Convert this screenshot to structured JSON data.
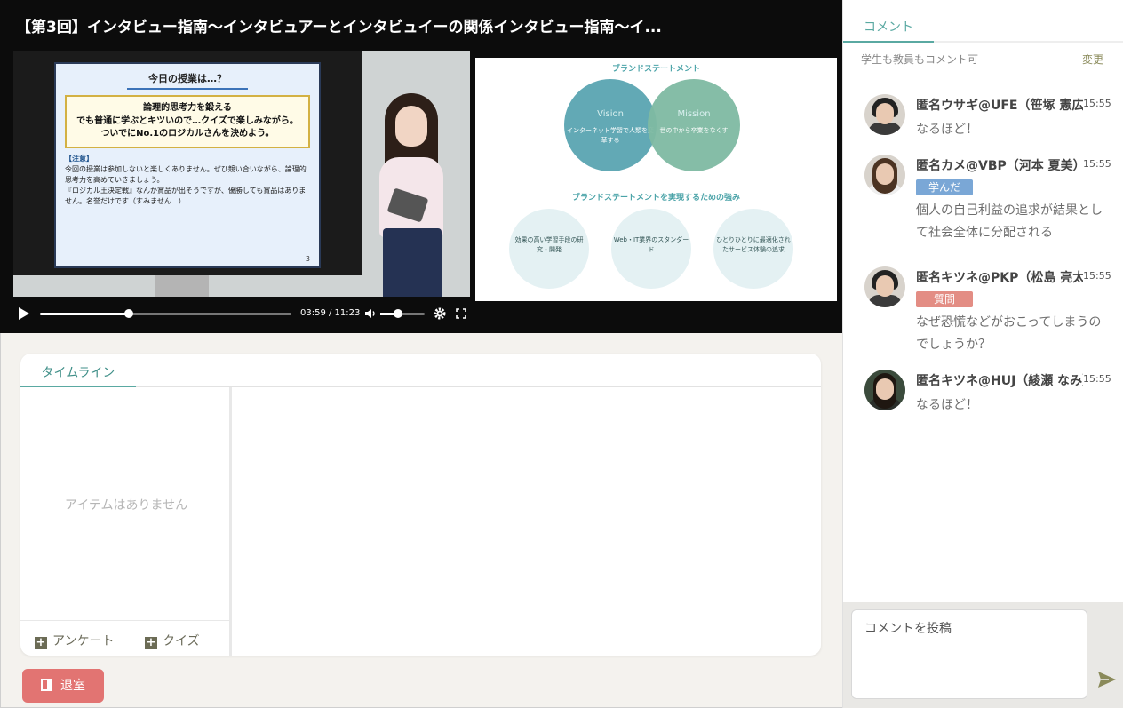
{
  "video": {
    "title": "【第3回】インタビュー指南〜インタビュアーとインタビュイーの関係インタビュー指南〜イ...",
    "time_display": "03:59 / 11:23",
    "progress_fraction": 0.353,
    "volume_fraction": 0.4,
    "camera_slide": {
      "heading": "今日の授業は…？",
      "box_lines": [
        "論理的思考力を鍛える",
        "でも普通に学ぶとキツいので…クイズで楽しみながら。",
        "ついでにNo.1のロジカルさんを決めよう。"
      ],
      "note_title": "【注意】",
      "notes": [
        "今回の授業は参加しないと楽しくありません。ぜひ競い合いながら、論理的思考力を高めていきましょう。",
        "『ロジカル王決定戦』なんか賞品が出そうですが、優勝しても賞品はありません。名誉だけです（すみません…）"
      ],
      "page": "3"
    },
    "doc_slide": {
      "title1": "ブランドステートメント",
      "vision_word": "Vision",
      "vision_text": "インターネット学習で人類を変革する",
      "mission_word": "Mission",
      "mission_text": "世の中から卒業をなくす",
      "title2": "ブランドステートメントを実現するための強み",
      "strengths": [
        "効果の高い学習手段の研究・開発",
        "Web・IT業界のスタンダード",
        "ひとりひとりに最適化されたサービス体験の追求"
      ]
    }
  },
  "timeline": {
    "tab_label": "タイムライン",
    "empty_text": "アイテムはありません",
    "survey_label": "アンケート",
    "quiz_label": "クイズ"
  },
  "leave_label": "退室",
  "comments_panel": {
    "tab_label": "コメント",
    "permission_text": "学生も教員もコメント可",
    "change_label": "変更",
    "input_placeholder": "コメントを投稿",
    "items": [
      {
        "name": "匿名ウサギ@UFE（笹塚 憲広）",
        "time": "15:55",
        "badge": "",
        "text": "なるほど！"
      },
      {
        "name": "匿名カメ@VBP（河本 夏美）",
        "time": "15:55",
        "badge": "学んだ",
        "text": "個人の自己利益の追求が結果として社会全体に分配される"
      },
      {
        "name": "匿名キツネ@PKP（松島 亮太）",
        "time": "15:55",
        "badge": "質問",
        "text": "なぜ恐慌などがおこってしまうのでしょうか？"
      },
      {
        "name": "匿名キツネ@HUJ（綾瀬 なみ）",
        "time": "15:55",
        "badge": "",
        "text": "なるほど！"
      }
    ]
  },
  "colors": {
    "accent": "#5aa9a2",
    "leave": "#e27472",
    "badge_learn": "#7aa7d6",
    "badge_question": "#e38d84"
  }
}
